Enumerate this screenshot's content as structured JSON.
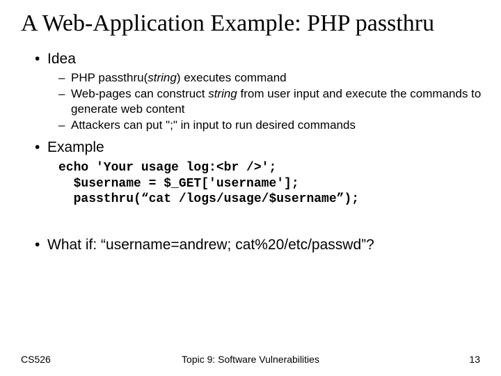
{
  "title": "A Web-Application Example: PHP passthru",
  "bullets": [
    {
      "label": "Idea",
      "subs": [
        {
          "pre": "PHP passthru(",
          "it": "string",
          "post": ") executes command"
        },
        {
          "pre": "Web-pages can construct ",
          "it": "string",
          "post": " from user input and execute the commands to generate web content"
        },
        {
          "pre": "Attackers can put \";\" in input to run desired commands",
          "it": "",
          "post": ""
        }
      ]
    },
    {
      "label": "Example",
      "code": "echo 'Your usage log:<br />';\n  $username = $_GET['username'];\n  passthru(“cat /logs/usage/$username”);"
    },
    {
      "label": "What if: “username=andrew; cat%20/etc/passwd”?"
    }
  ],
  "footer": {
    "left": "CS526",
    "center": "Topic 9: Software Vulnerabilities",
    "right": "13"
  }
}
